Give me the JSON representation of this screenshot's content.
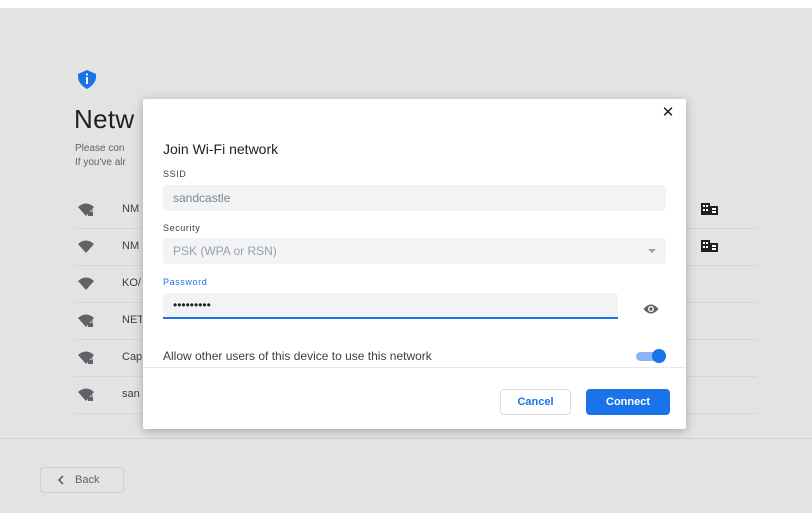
{
  "background": {
    "title": "Netw",
    "subtitle_lines": [
      "Please con",
      "If you've alr"
    ],
    "networks": [
      {
        "name": "NM",
        "secured": true,
        "enterprise": true
      },
      {
        "name": "NM",
        "secured": false,
        "enterprise": true
      },
      {
        "name": "KO/",
        "secured": false,
        "enterprise": false
      },
      {
        "name": "NET",
        "secured": true,
        "enterprise": false
      },
      {
        "name": "Cap",
        "secured": true,
        "enterprise": false
      },
      {
        "name": "san",
        "secured": true,
        "enterprise": false
      }
    ],
    "back_label": "Back"
  },
  "dialog": {
    "title": "Join Wi-Fi network",
    "ssid_label": "SSID",
    "ssid_value": "sandcastle",
    "security_label": "Security",
    "security_value": "PSK (WPA or RSN)",
    "password_label": "Password",
    "password_value": "password1",
    "share_label": "Allow other users of this device to use this network",
    "share_enabled": true,
    "cancel_label": "Cancel",
    "connect_label": "Connect"
  },
  "colors": {
    "accent": "#1a73e8",
    "toggle_track": "#8ab4f8",
    "background": "#e3e3e3"
  },
  "icons": [
    "shield-info-icon",
    "wifi-icon",
    "lock-icon",
    "enterprise-icon",
    "eye-icon",
    "close-icon",
    "chevron-left-icon",
    "dropdown-arrow-icon"
  ]
}
